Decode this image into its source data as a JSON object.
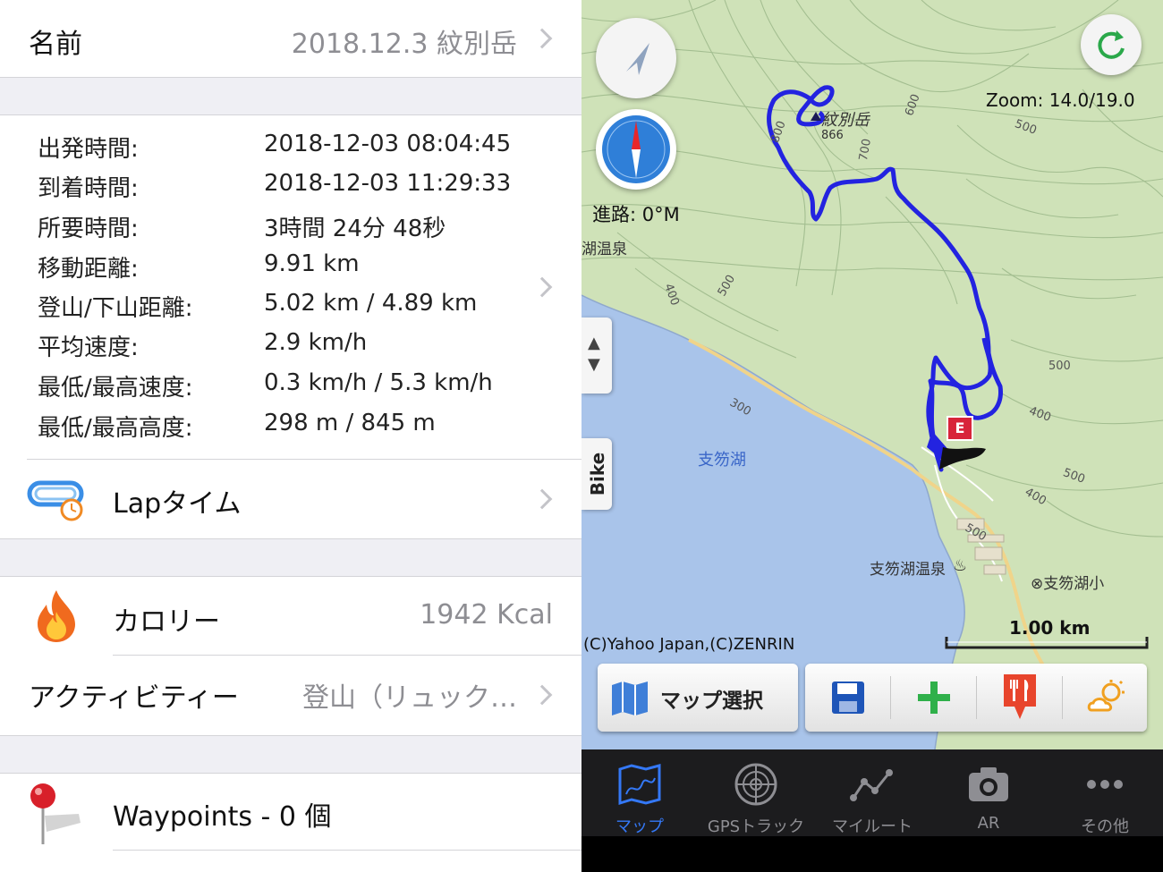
{
  "left": {
    "name_label": "名前",
    "name_value": "2018.12.3 紋別岳",
    "stats": [
      {
        "label": "出発時間:",
        "value": "2018-12-03 08:04:45"
      },
      {
        "label": "到着時間:",
        "value": "2018-12-03 11:29:33"
      },
      {
        "label": "所要時間:",
        "value": "3時間 24分 48秒"
      },
      {
        "label": "移動距離:",
        "value": "9.91 km"
      },
      {
        "label": "登山/下山距離:",
        "value": "5.02 km / 4.89 km"
      },
      {
        "label": "平均速度:",
        "value": "2.9 km/h"
      },
      {
        "label": "最低/最高速度:",
        "value": "0.3 km/h / 5.3 km/h"
      },
      {
        "label": "最低/最高高度:",
        "value": "298 m / 845 m"
      }
    ],
    "lap_label": "Lapタイム",
    "calorie_label": "カロリー",
    "calorie_value": "1942 Kcal",
    "activity_label": "アクティビティー",
    "activity_value": "登山（リュック…",
    "waypoints_label": "Waypoints - 0 個"
  },
  "map": {
    "heading": "進路: 0°M",
    "zoom": "Zoom: 14.0/19.0",
    "peak_name": "紋別岳",
    "peak_elev": "866",
    "lake_name": "支笏湖",
    "onsen_label": "支笏湖温泉",
    "onsen_partial": "湖温泉",
    "school_label": "⊗支笏湖小",
    "copyright": "(C)Yahoo Japan,(C)ZENRIN",
    "scale": "1.00 km",
    "contours": [
      "800",
      "600",
      "700",
      "500",
      "500",
      "400",
      "500",
      "400",
      "300",
      "400",
      "500",
      "500",
      "400"
    ],
    "bike_tab": "Bike",
    "map_select_label": "マップ選択",
    "end_marker": "E",
    "track_color": "#2323e0"
  },
  "tabs": [
    {
      "label": "マップ",
      "icon": "map-icon",
      "active": true
    },
    {
      "label": "GPSトラック",
      "icon": "radar-icon",
      "active": false
    },
    {
      "label": "マイルート",
      "icon": "route-icon",
      "active": false
    },
    {
      "label": "AR",
      "icon": "camera-icon",
      "active": false
    },
    {
      "label": "その他",
      "icon": "more-icon",
      "active": false
    }
  ],
  "colors": {
    "tab_active": "#3478f6",
    "tab_inactive": "#8e8e93"
  }
}
